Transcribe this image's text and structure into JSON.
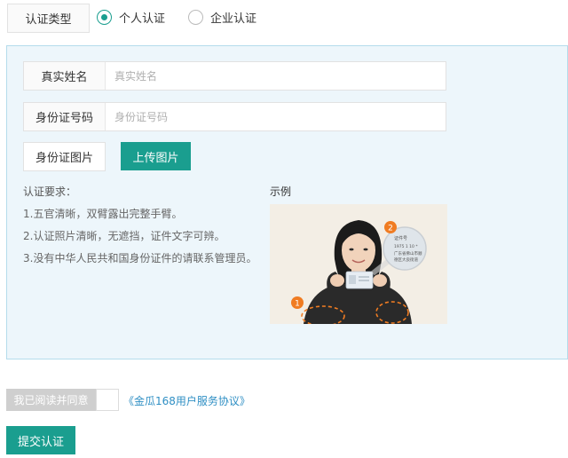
{
  "auth_type": {
    "label": "认证类型",
    "options": [
      {
        "label": "个人认证",
        "checked": true
      },
      {
        "label": "企业认证",
        "checked": false
      }
    ]
  },
  "form": {
    "name": {
      "label": "真实姓名",
      "placeholder": "真实姓名",
      "value": ""
    },
    "id_number": {
      "label": "身份证号码",
      "placeholder": "身份证号码",
      "value": ""
    },
    "id_photo": {
      "label": "身份证图片",
      "upload_label": "上传图片"
    }
  },
  "requirements": {
    "title": "认证要求：",
    "items": [
      "1.五官清晰，双臂露出完整手臂。",
      "2.认证照片清晰，无遮挡，证件文字可辨。",
      "3.没有中华人民共和国身份证件的请联系管理员。"
    ]
  },
  "example": {
    "title": "示例",
    "markers": [
      "1",
      "2"
    ],
    "card_lines": [
      "证件号",
      "1975  1 10 *",
      "广东省佛山市顺",
      "德区大良街道"
    ]
  },
  "agreement": {
    "accept_label": "我已阅读并同意",
    "link_text": "《金瓜168用户服务协议》"
  },
  "submit_label": "提交认证",
  "colors": {
    "accent": "#1a9e8f",
    "panel_bg": "#edf6fb",
    "panel_border": "#b5dcec",
    "link": "#2f8fc4",
    "marker": "#f07c22"
  }
}
